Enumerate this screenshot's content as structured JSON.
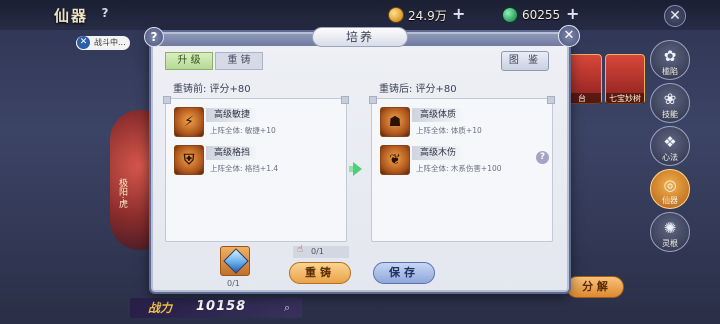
{
  "background": {
    "title": "仙器",
    "help_glyph": "?",
    "gold_value": "24.9万",
    "gem_value": "60255",
    "plus_glyph": "+",
    "close_glyph": "✕",
    "battle_tag": "战斗中...",
    "battle_tag_x": "✕",
    "left_art_label": "极阳·虎",
    "bag_items": [
      {
        "label": "台"
      },
      {
        "label": "七宝妙树"
      }
    ],
    "sidebar": [
      {
        "label": "槛陷",
        "glyph": "✿",
        "icon": "flower-icon"
      },
      {
        "label": "技能",
        "glyph": "❀",
        "icon": "skill-icon"
      },
      {
        "label": "心法",
        "glyph": "❖",
        "icon": "mind-icon"
      },
      {
        "label": "仙器",
        "glyph": "◎",
        "icon": "artifact-icon"
      },
      {
        "label": "灵根",
        "glyph": "✺",
        "icon": "root-icon"
      }
    ],
    "power_label": "战力",
    "power_value": "10158",
    "power_search_glyph": "⌕",
    "decompose_label": "分 解"
  },
  "modal": {
    "title": "培养",
    "help_glyph": "?",
    "close_glyph": "✕",
    "tabs": [
      {
        "label": "升 级",
        "active": true
      },
      {
        "label": "重 铸",
        "active": false
      }
    ],
    "gallery_label": "图 鉴",
    "before_title": "重铸前: 评分+80",
    "after_title": "重铸后: 评分+80",
    "before_attrs": [
      {
        "name": "高级敏捷",
        "desc": "上阵全体: 敏捷+10",
        "glyph": "⚡",
        "icon": "agility-icon"
      },
      {
        "name": "高级格挡",
        "desc": "上阵全体: 格挡+1.4",
        "glyph": "⛨",
        "icon": "block-icon"
      }
    ],
    "after_attrs": [
      {
        "name": "高级体质",
        "desc": "上阵全体: 体质+10",
        "glyph": "☗",
        "icon": "constitution-icon"
      },
      {
        "name": "高级木伤",
        "desc": "上阵全体: 木系伤害+100",
        "glyph": "❦",
        "icon": "wood-damage-icon"
      }
    ],
    "question_glyph": "?",
    "material_count": "0/1",
    "cost_text": "0/1",
    "cost_hand_glyph": "☝",
    "recast_label": "重铸",
    "save_label": "保存"
  }
}
